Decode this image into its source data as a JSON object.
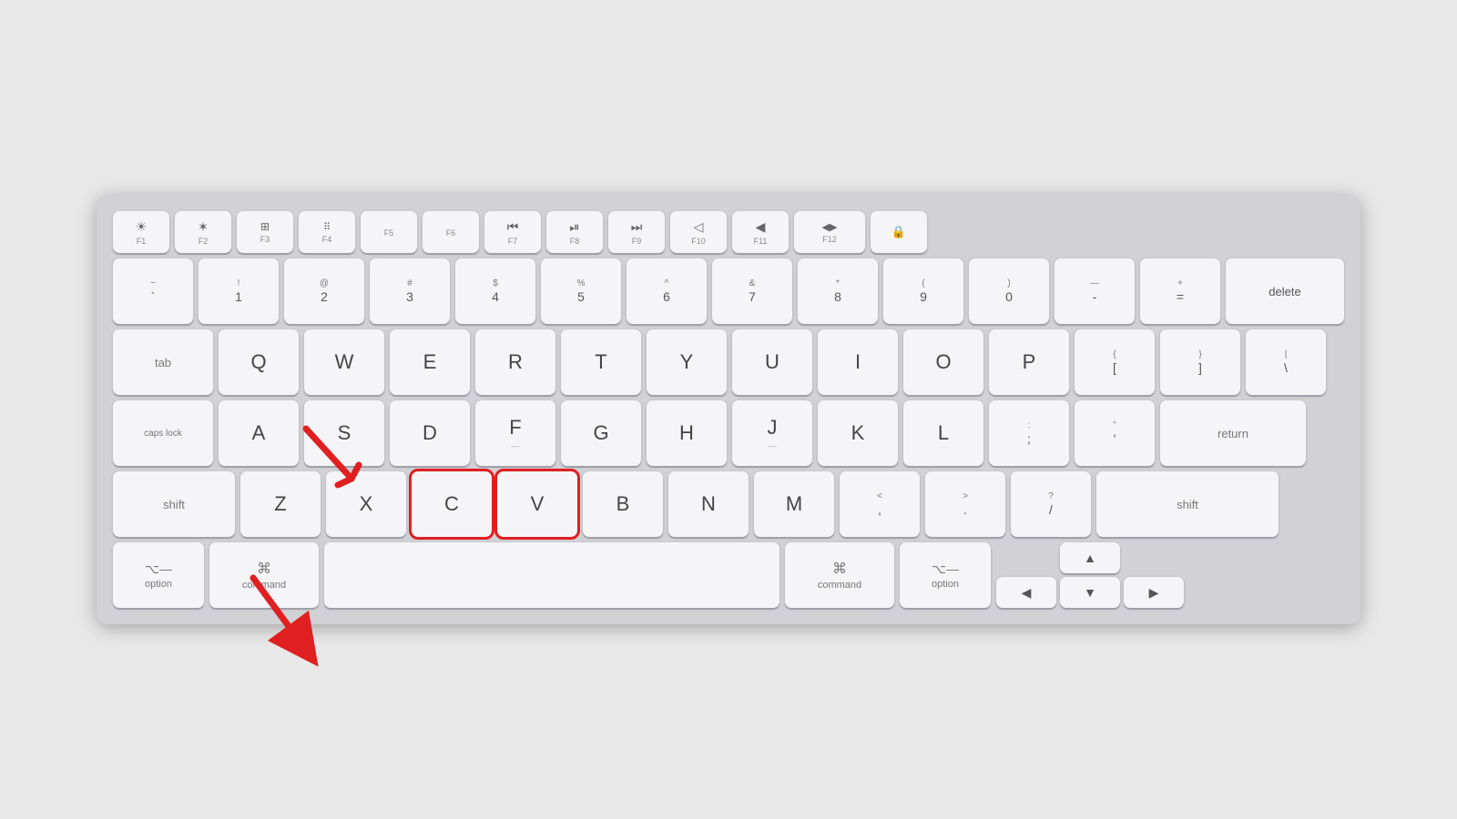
{
  "keyboard": {
    "rows": {
      "fn_row": {
        "keys": [
          {
            "id": "f1",
            "bottom": "F1",
            "icon": "☀",
            "small": true
          },
          {
            "id": "f2",
            "bottom": "F2",
            "icon": "✶",
            "small": true
          },
          {
            "id": "f3",
            "bottom": "F3",
            "icon": "⊞",
            "small": true
          },
          {
            "id": "f4",
            "bottom": "F4",
            "icon": "⠿",
            "small": true
          },
          {
            "id": "f5",
            "bottom": "F5",
            "icon": "",
            "small": true
          },
          {
            "id": "f6",
            "bottom": "F6",
            "icon": "",
            "small": true
          },
          {
            "id": "f7",
            "bottom": "F7",
            "icon": "⏮",
            "small": true
          },
          {
            "id": "f8",
            "bottom": "F8",
            "icon": "⏯",
            "small": true
          },
          {
            "id": "f9",
            "bottom": "F9",
            "icon": "⏭",
            "small": true
          },
          {
            "id": "f10",
            "bottom": "F10",
            "icon": "◁",
            "small": true
          },
          {
            "id": "f11",
            "bottom": "F11",
            "icon": "◀",
            "small": true
          },
          {
            "id": "f12",
            "bottom": "F12",
            "icon": "◀▶",
            "small": true
          },
          {
            "id": "lock",
            "icon": "🔒",
            "small": true
          }
        ]
      }
    },
    "option_label": "option",
    "command_label": "command",
    "option_symbol": "⌥",
    "command_symbol": "⌘",
    "delete_label": "delete",
    "return_label": "return",
    "shift_label": "shift",
    "tab_label": "tab",
    "caps_label": "caps lock"
  },
  "highlight": {
    "keys": [
      "C",
      "V"
    ],
    "color": "#e02020"
  },
  "arrow": {
    "direction": "down-right",
    "color": "#e02020"
  }
}
